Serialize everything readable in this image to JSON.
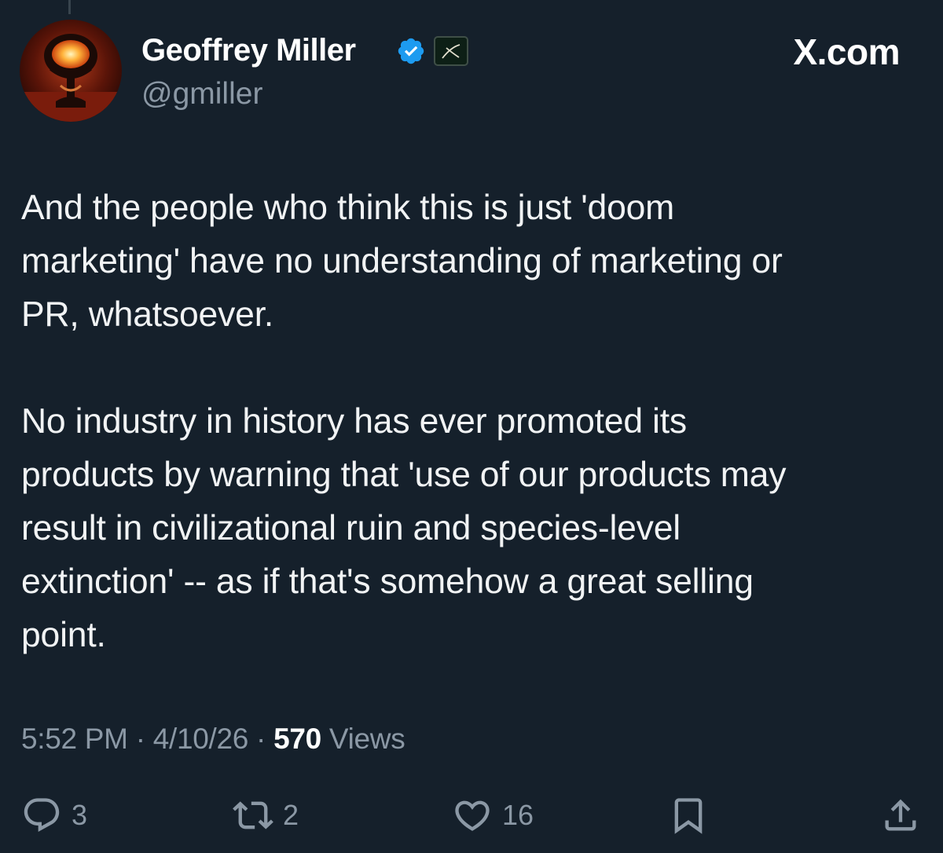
{
  "author": {
    "display_name": "Geoffrey Miller",
    "handle": "@gmiller",
    "verified_icon": "verified-badge-icon",
    "affiliate_icon": "affiliate-badge-icon"
  },
  "brand": {
    "label": "X.com"
  },
  "tweet": {
    "paragraphs": [
      "And the people who think this is just 'doom\nmarketing' have no understanding of marketing or\nPR, whatsoever.",
      "No industry in history has ever promoted its\nproducts by warning that 'use of our products may\nresult in civilizational ruin and species-level\nextinction' -- as if that's somehow a great selling\npoint."
    ]
  },
  "meta": {
    "time": "5:52 PM",
    "separator": "·",
    "date": "4/10/26",
    "views_count": "570",
    "views_label": "Views"
  },
  "actions": {
    "reply_count": "3",
    "retweet_count": "2",
    "like_count": "16"
  },
  "colors": {
    "background": "#15202b",
    "text": "#e7e9ea",
    "secondary_text": "#8b98a5",
    "verified": "#1d9bf0"
  }
}
